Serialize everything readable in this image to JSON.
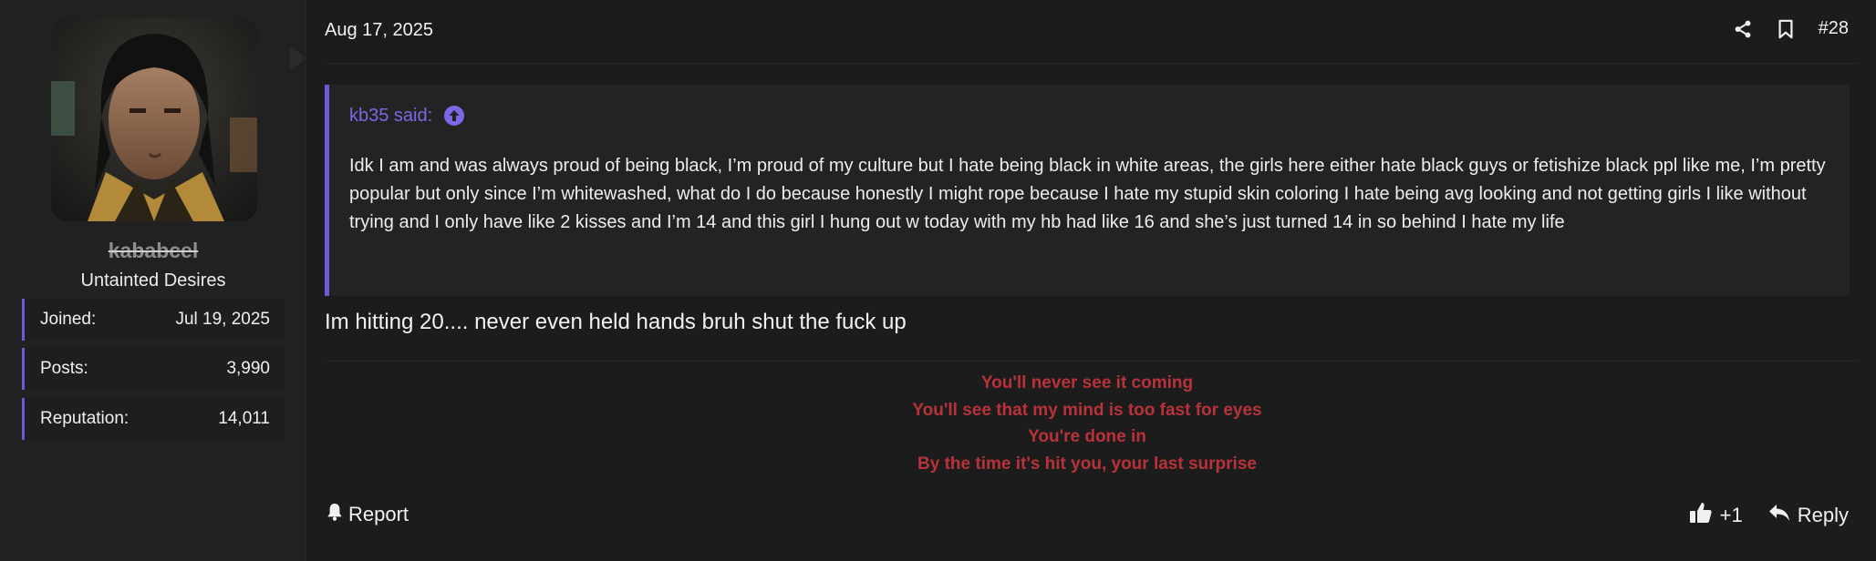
{
  "user": {
    "name": "kababcel",
    "title": "Untainted Desires",
    "stats": [
      {
        "label": "Joined:",
        "value": "Jul 19, 2025"
      },
      {
        "label": "Posts:",
        "value": "3,990"
      },
      {
        "label": "Reputation:",
        "value": "14,011"
      }
    ]
  },
  "post": {
    "date": "Aug 17, 2025",
    "number": "#28",
    "quote": {
      "author_label": "kb35 said:",
      "text": "Idk I am and was always proud of being black, I’m proud of my culture but I hate being black in white areas, the girls here either hate black guys or fetishize black ppl like me, I’m pretty popular but only since I’m whitewashed, what do I do because honestly I might rope because I hate my stupid skin coloring I hate being avg looking and not getting girls I like without trying and I only have like 2 kisses and I’m 14 and this girl I hung out w today with my hb had like 16 and she’s just turned 14 in so behind I hate my life"
    },
    "message": "Im hitting 20.... never even held hands bruh shut the fuck up",
    "signature": [
      "You'll never see it coming",
      "You'll see that my mind is too fast for eyes",
      "You're done in",
      "By the time it's hit you, your last surprise"
    ],
    "actions": {
      "report_label": "Report",
      "reaction_label": "+1",
      "reply_label": "Reply"
    }
  },
  "colors": {
    "accent": "#6b5bd6",
    "quote_author": "#7b68e6",
    "signature": "#b8323a"
  },
  "icons": [
    "share-icon",
    "bookmark-icon",
    "arrow-up-circle-icon",
    "bell-icon",
    "thumbs-up-icon",
    "reply-arrow-icon"
  ]
}
